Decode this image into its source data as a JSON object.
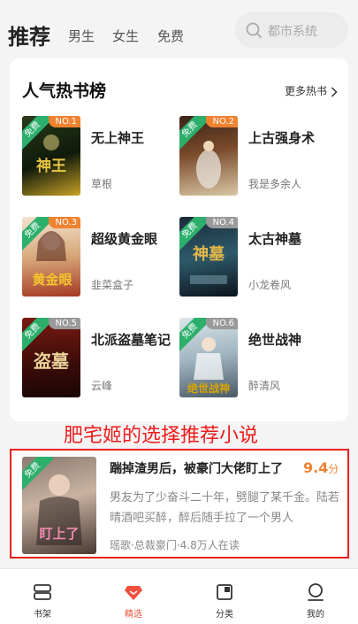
{
  "header": {
    "tabs": [
      {
        "label": "推荐"
      },
      {
        "label": "男生"
      },
      {
        "label": "女生"
      },
      {
        "label": "免费"
      }
    ],
    "search": {
      "placeholder": "都市系统"
    }
  },
  "hot_list": {
    "title": "人气热书榜",
    "more_label": "更多热书",
    "free_tag": "免费",
    "books": [
      {
        "rank": "NO.1",
        "name": "无上神王",
        "author": "草根"
      },
      {
        "rank": "NO.2",
        "name": "上古强身术",
        "author": "我是多余人"
      },
      {
        "rank": "NO.3",
        "name": "超级黄金眼",
        "author": "韭菜盒子"
      },
      {
        "rank": "NO.4",
        "name": "太古神墓",
        "author": "小龙卷风"
      },
      {
        "rank": "NO.5",
        "name": "北派盗墓笔记",
        "author": "云峰"
      },
      {
        "rank": "NO.6",
        "name": "绝世战神",
        "author": "醉清风"
      }
    ]
  },
  "caption": "肥宅姬的选择推荐小说",
  "featured": {
    "free_tag": "免费",
    "title": "踹掉渣男后，被豪门大佬盯上了",
    "score": "9.4",
    "score_unit": "分",
    "description": "男友为了少奋斗二十年，劈腿了某千金。陆若晴酒吧买醉，醉后随手拉了一个男人",
    "meta": "瑶歌·总裁豪门·4.8万人在读"
  },
  "bottom_nav": [
    {
      "label": "书架",
      "icon": "bookshelf-icon"
    },
    {
      "label": "精选",
      "icon": "diamond-icon"
    },
    {
      "label": "分类",
      "icon": "category-icon"
    },
    {
      "label": "我的",
      "icon": "profile-icon"
    }
  ],
  "colors": {
    "accent": "#f0503c",
    "rank_top": "#f08230",
    "rank_other": "#9a9a9a",
    "free_ribbon": "#2daf6c",
    "highlight_red": "#e82020"
  }
}
